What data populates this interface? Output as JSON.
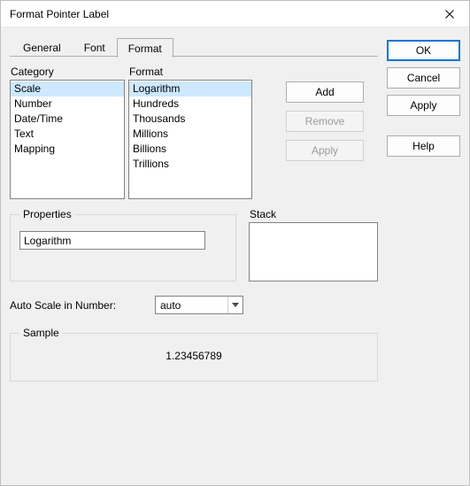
{
  "window": {
    "title": "Format Pointer Label"
  },
  "tabs": {
    "general": "General",
    "font": "Font",
    "format": "Format"
  },
  "right_buttons": {
    "ok": "OK",
    "cancel": "Cancel",
    "apply": "Apply",
    "help": "Help"
  },
  "labels": {
    "category": "Category",
    "format": "Format",
    "properties": "Properties",
    "stack": "Stack",
    "auto_scale": "Auto Scale in Number:",
    "sample": "Sample"
  },
  "list_buttons": {
    "add": "Add",
    "remove": "Remove",
    "apply": "Apply"
  },
  "category_items": [
    "Scale",
    "Number",
    "Date/Time",
    "Text",
    "Mapping"
  ],
  "format_items": [
    "Logarithm",
    "Hundreds",
    "Thousands",
    "Millions",
    "Billions",
    "Trillions"
  ],
  "properties_value": "Logarithm",
  "auto_scale_value": "auto",
  "sample_value": "1.23456789",
  "selected": {
    "category_index": 0,
    "format_index": 0
  }
}
